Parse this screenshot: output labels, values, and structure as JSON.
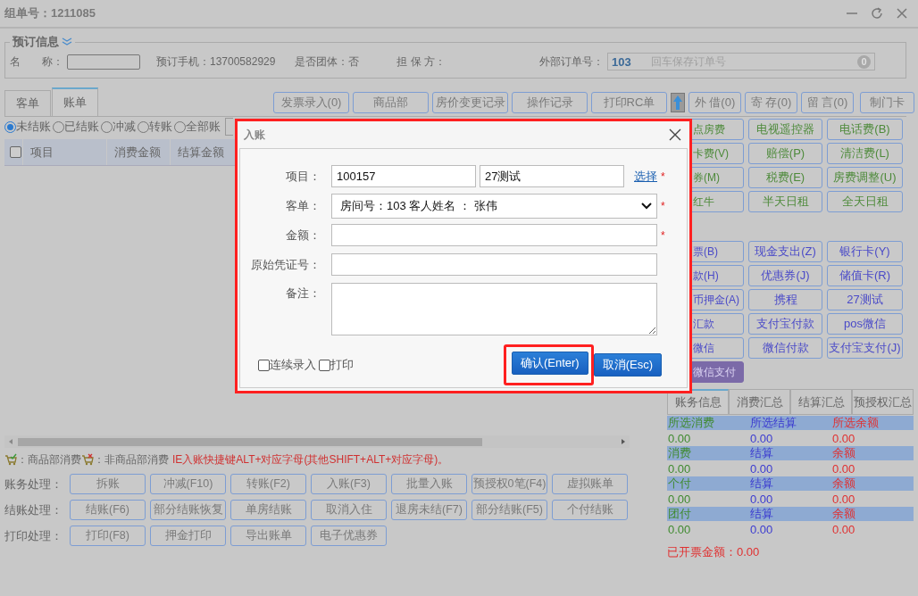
{
  "window": {
    "title": "组单号：1211085"
  },
  "booking": {
    "legend": "预订信息",
    "name_label": "名　　称：",
    "phone": "预订手机：13700582929",
    "group": "是否团体：否",
    "guarantor": "担 保 方：",
    "external_label": "外部订单号：",
    "external_value": "103",
    "external_placeholder": "回车保存订单号",
    "external_count": "0"
  },
  "tabs": [
    {
      "label": "客单",
      "selected": false
    },
    {
      "label": "账单",
      "selected": true
    }
  ],
  "toolbar": [
    {
      "kind": "button",
      "label": "发票录入(0)"
    },
    {
      "kind": "button",
      "label": "商品部"
    },
    {
      "kind": "button",
      "label": "房价变更记录"
    },
    {
      "kind": "button",
      "label": "操作记录"
    },
    {
      "kind": "button",
      "label": "打印RC单"
    },
    {
      "kind": "arrow"
    },
    {
      "kind": "small",
      "label": "外 借(0)"
    },
    {
      "kind": "small",
      "label": "寄 存(0)"
    },
    {
      "kind": "small",
      "label": "留 言(0)"
    },
    {
      "kind": "small",
      "label": "制门卡"
    }
  ],
  "filters": [
    {
      "label": "未结账",
      "selected": true
    },
    {
      "label": "已结账",
      "selected": false
    },
    {
      "label": "冲减",
      "selected": false
    },
    {
      "label": "转账",
      "selected": false
    },
    {
      "label": "全部账",
      "selected": false
    }
  ],
  "bill_table": {
    "all_checked": false,
    "columns": [
      "项目",
      "消费金额",
      "结算金额"
    ]
  },
  "legend": {
    "goods": "：商品部消费",
    "non_goods": "：非商品部消费",
    "hint": "IE入账快捷键ALT+对应字母(其他SHIFT+ALT+对应字母)。"
  },
  "actions": [
    {
      "label": "账务处理：",
      "buttons": [
        "拆账",
        "冲减(F10)",
        "转账(F2)",
        "入账(F3)",
        "批量入账",
        "预授权0笔(F4)",
        "虚拟账单"
      ]
    },
    {
      "label": "结账处理：",
      "buttons": [
        "结账(F6)",
        "部分结账恢复",
        "单房结账",
        "取消入住",
        "退房未结(F7)",
        "部分结账(F5)",
        "个付结账"
      ]
    },
    {
      "label": "打印处理：",
      "buttons": [
        "打印(F8)",
        "押金打印",
        "导出账单",
        "电子优惠券"
      ]
    }
  ],
  "charge_buttons": [
    {
      "label": "点房费",
      "partial": true
    },
    {
      "label": "电视遥控器",
      "partial": false
    },
    {
      "label": "电话费(B)",
      "partial": false
    },
    {
      "label": "卡费(V)",
      "partial": true
    },
    {
      "label": "赔偿(P)",
      "partial": false
    },
    {
      "label": "清洁费(L)",
      "partial": false
    },
    {
      "label": "券(M)",
      "partial": true
    },
    {
      "label": "税费(E)",
      "partial": false
    },
    {
      "label": "房费调整(U)",
      "partial": false
    },
    {
      "label": "红牛",
      "partial": true
    },
    {
      "label": "半天日租",
      "partial": false
    },
    {
      "label": "全天日租",
      "partial": false
    }
  ],
  "payment_buttons": [
    {
      "label": "票(B)",
      "partial": true,
      "selected": false
    },
    {
      "label": "现金支出(Z)",
      "partial": false,
      "selected": false
    },
    {
      "label": "银行卡(Y)",
      "partial": false,
      "selected": false
    },
    {
      "label": "款(H)",
      "partial": true,
      "selected": false
    },
    {
      "label": "优惠券(J)",
      "partial": false,
      "selected": false
    },
    {
      "label": "储值卡(R)",
      "partial": false,
      "selected": false
    },
    {
      "label": "币押金(A)",
      "partial": true,
      "selected": false
    },
    {
      "label": "携程",
      "partial": false,
      "selected": false
    },
    {
      "label": "27测试",
      "partial": false,
      "selected": false
    },
    {
      "label": "汇款",
      "partial": true,
      "selected": false
    },
    {
      "label": "支付宝付款",
      "partial": false,
      "selected": false
    },
    {
      "label": "pos微信",
      "partial": false,
      "selected": false
    },
    {
      "label": "微信",
      "partial": true,
      "selected": false
    },
    {
      "label": "微信付款",
      "partial": false,
      "selected": false
    },
    {
      "label": "支付宝支付(J)",
      "partial": false,
      "selected": false
    },
    {
      "label": "微信支付",
      "partial": true,
      "selected": true
    }
  ],
  "info_tabs": [
    {
      "label": "账务信息",
      "selected": true
    },
    {
      "label": "消费汇总",
      "selected": false
    },
    {
      "label": "结算汇总",
      "selected": false
    },
    {
      "label": "预授权汇总",
      "selected": false
    }
  ],
  "info_rows": [
    {
      "kind": "header",
      "cells": [
        "所选消费",
        "所选结算",
        "所选余额"
      ]
    },
    {
      "kind": "values",
      "cells": [
        "0.00",
        "0.00",
        "0.00"
      ]
    },
    {
      "kind": "header",
      "cells": [
        "消费",
        "结算",
        "余额"
      ]
    },
    {
      "kind": "values",
      "cells": [
        "0.00",
        "0.00",
        "0.00"
      ]
    },
    {
      "kind": "header",
      "cells": [
        "个付",
        "结算",
        "余额"
      ]
    },
    {
      "kind": "values",
      "cells": [
        "0.00",
        "0.00",
        "0.00"
      ]
    },
    {
      "kind": "header",
      "cells": [
        "团付",
        "结算",
        "余额"
      ]
    },
    {
      "kind": "values",
      "cells": [
        "0.00",
        "0.00",
        "0.00"
      ]
    }
  ],
  "invoiced": "已开票金额：0.00",
  "dialog": {
    "title": "入账",
    "fields": [
      {
        "kind": "item",
        "label": "项目：",
        "values": [
          "100157",
          "27测试"
        ],
        "link": "选择",
        "mark": "*"
      },
      {
        "kind": "select",
        "label": "客单：",
        "value": "房间号：103 客人姓名 ： 张伟",
        "mark": "*"
      },
      {
        "kind": "input",
        "label": "金额：",
        "mark": "*"
      },
      {
        "kind": "input",
        "label": "原始凭证号："
      },
      {
        "kind": "textarea",
        "label": "备注："
      }
    ],
    "options": [
      {
        "label": "连续录入",
        "checked": false
      },
      {
        "label": "打印",
        "checked": false
      }
    ],
    "buttons": [
      {
        "label": "确认(Enter)",
        "highlighted": true
      },
      {
        "label": "取消(Esc)",
        "highlighted": false
      }
    ]
  }
}
